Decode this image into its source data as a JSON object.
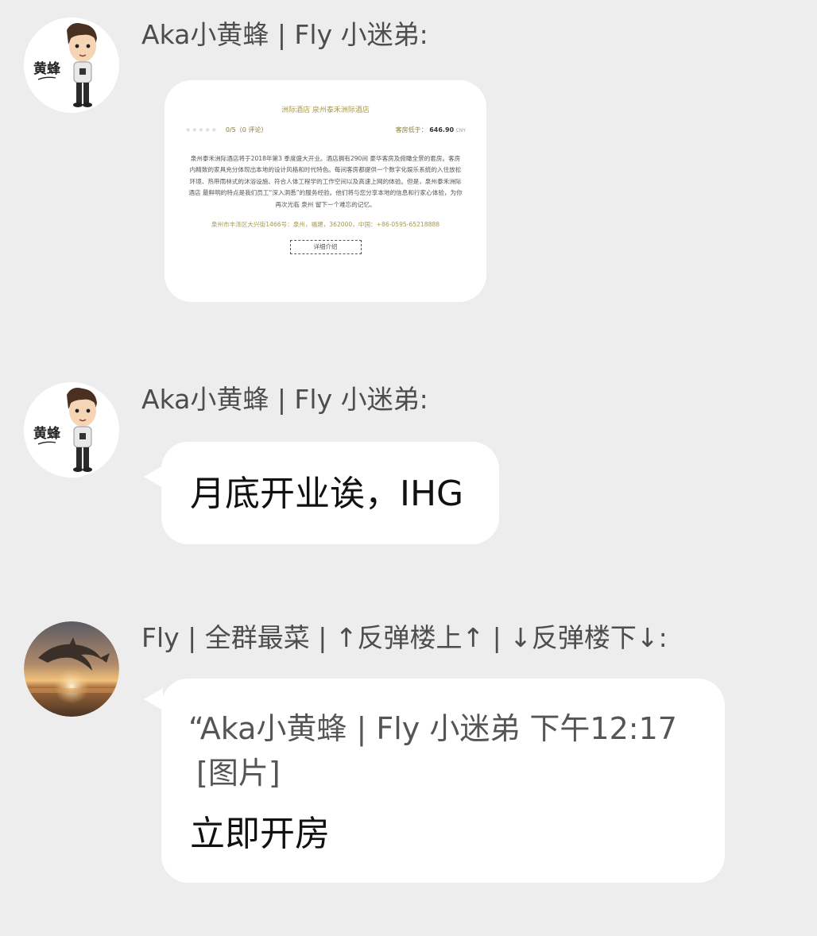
{
  "messages": [
    {
      "sender": "Aka小黄蜂 | Fly 小迷弟:",
      "avatar": {
        "label": "黄蜂",
        "icon": "cartoon-boy-avatar-icon"
      },
      "card": {
        "title": "洲际酒店 泉州泰禾洲际酒店",
        "stars": "★★★★★",
        "rating": "0/5（0 评论）",
        "price_label": "客房低于：",
        "price": "646.90",
        "currency": "CNY",
        "description": "泉州泰禾洲际酒店将于2018年第3 季度盛大开业。酒店拥有290间 豪华客房及俯瞰全景的套房。客房内精致的家具充分体现出本地的设计风格和时代特色。每间客房都提供一个数字化娱乐系统的入住放松环境、热带雨林式的沐浴设施、符合人体工程学的工作空间以及高速上网的体验。但是，泉州泰禾洲际酒店 最鲜明的特点是我们员工“深入洞悉”的服务经验。他们将与您分享本地的信息和行家心体验，为你再次光临 泉州 留下一个难忘的记忆。",
        "address": "泉州市丰泽区大兴街1466号：泉州，福建，362000，中国：+86-0595-65218888",
        "button": "详细介绍"
      }
    },
    {
      "sender": "Aka小黄蜂 | Fly 小迷弟:",
      "avatar": {
        "label": "黄蜂",
        "icon": "cartoon-boy-avatar-icon"
      },
      "text": "月底开业诶，IHG"
    },
    {
      "sender": "Fly | 全群最菜 | ↑反弹楼上↑ | ↓反弹楼下↓:",
      "avatar": {
        "icon": "dolphin-sunset-avatar-icon"
      },
      "quote_line1": "“Aka小黄蜂 | Fly 小迷弟 下午12:17",
      "quote_line2": "[图片]",
      "text": "立即开房"
    }
  ],
  "colors": {
    "background": "#ededed",
    "bubble": "#ffffff",
    "sender_text": "#4d4d4d",
    "card_accent": "#a89a4a"
  }
}
